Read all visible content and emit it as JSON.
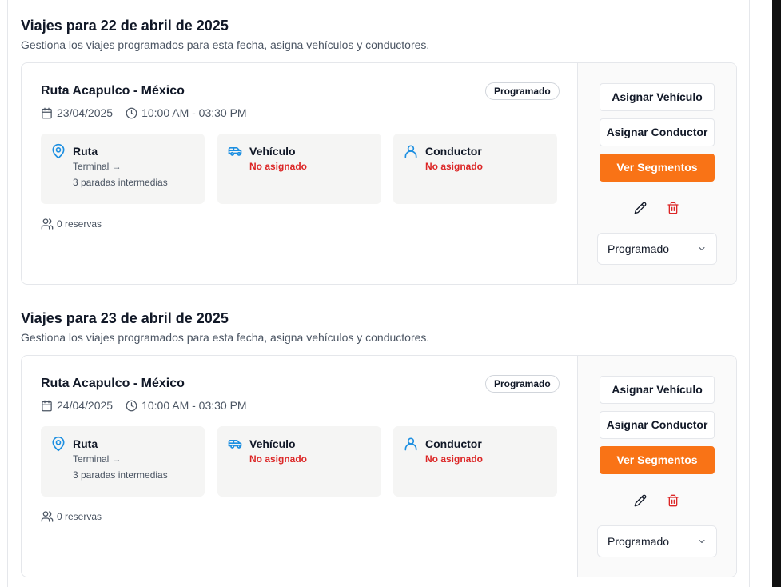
{
  "groups": [
    {
      "title": "Viajes para 22 de abril de 2025",
      "subtitle": "Gestiona los viajes programados para esta fecha, asigna vehículos y conductores.",
      "trip": {
        "route_name": "Ruta Acapulco - México",
        "status_badge": "Programado",
        "date": "23/04/2025",
        "time": "10:00 AM - 03:30 PM",
        "ruta": {
          "label": "Ruta",
          "value": "Terminal →",
          "stops": "3 paradas intermedias"
        },
        "vehiculo": {
          "label": "Vehículo",
          "value": "No asignado"
        },
        "conductor": {
          "label": "Conductor",
          "value": "No asignado"
        },
        "reservas": "0 reservas",
        "actions": {
          "assign_vehicle": "Asignar Vehículo",
          "assign_driver": "Asignar Conductor",
          "view_segments": "Ver Segmentos"
        },
        "status_select": "Programado"
      }
    },
    {
      "title": "Viajes para 23 de abril de 2025",
      "subtitle": "Gestiona los viajes programados para esta fecha, asigna vehículos y conductores.",
      "trip": {
        "route_name": "Ruta Acapulco - México",
        "status_badge": "Programado",
        "date": "24/04/2025",
        "time": "10:00 AM - 03:30 PM",
        "ruta": {
          "label": "Ruta",
          "value": "Terminal →",
          "stops": "3 paradas intermedias"
        },
        "vehiculo": {
          "label": "Vehículo",
          "value": "No asignado"
        },
        "conductor": {
          "label": "Conductor",
          "value": "No asignado"
        },
        "reservas": "0 reservas",
        "actions": {
          "assign_vehicle": "Asignar Vehículo",
          "assign_driver": "Asignar Conductor",
          "view_segments": "Ver Segmentos"
        },
        "status_select": "Programado"
      }
    }
  ],
  "colors": {
    "accent": "#f97316",
    "danger": "#dc2626",
    "icon_blue": "#1d8fe1",
    "muted": "#4b5563"
  },
  "icons": [
    "calendar-icon",
    "clock-icon",
    "map-pin-icon",
    "bus-icon",
    "user-icon",
    "users-icon",
    "pencil-icon",
    "trash-icon",
    "chevron-down-icon"
  ]
}
